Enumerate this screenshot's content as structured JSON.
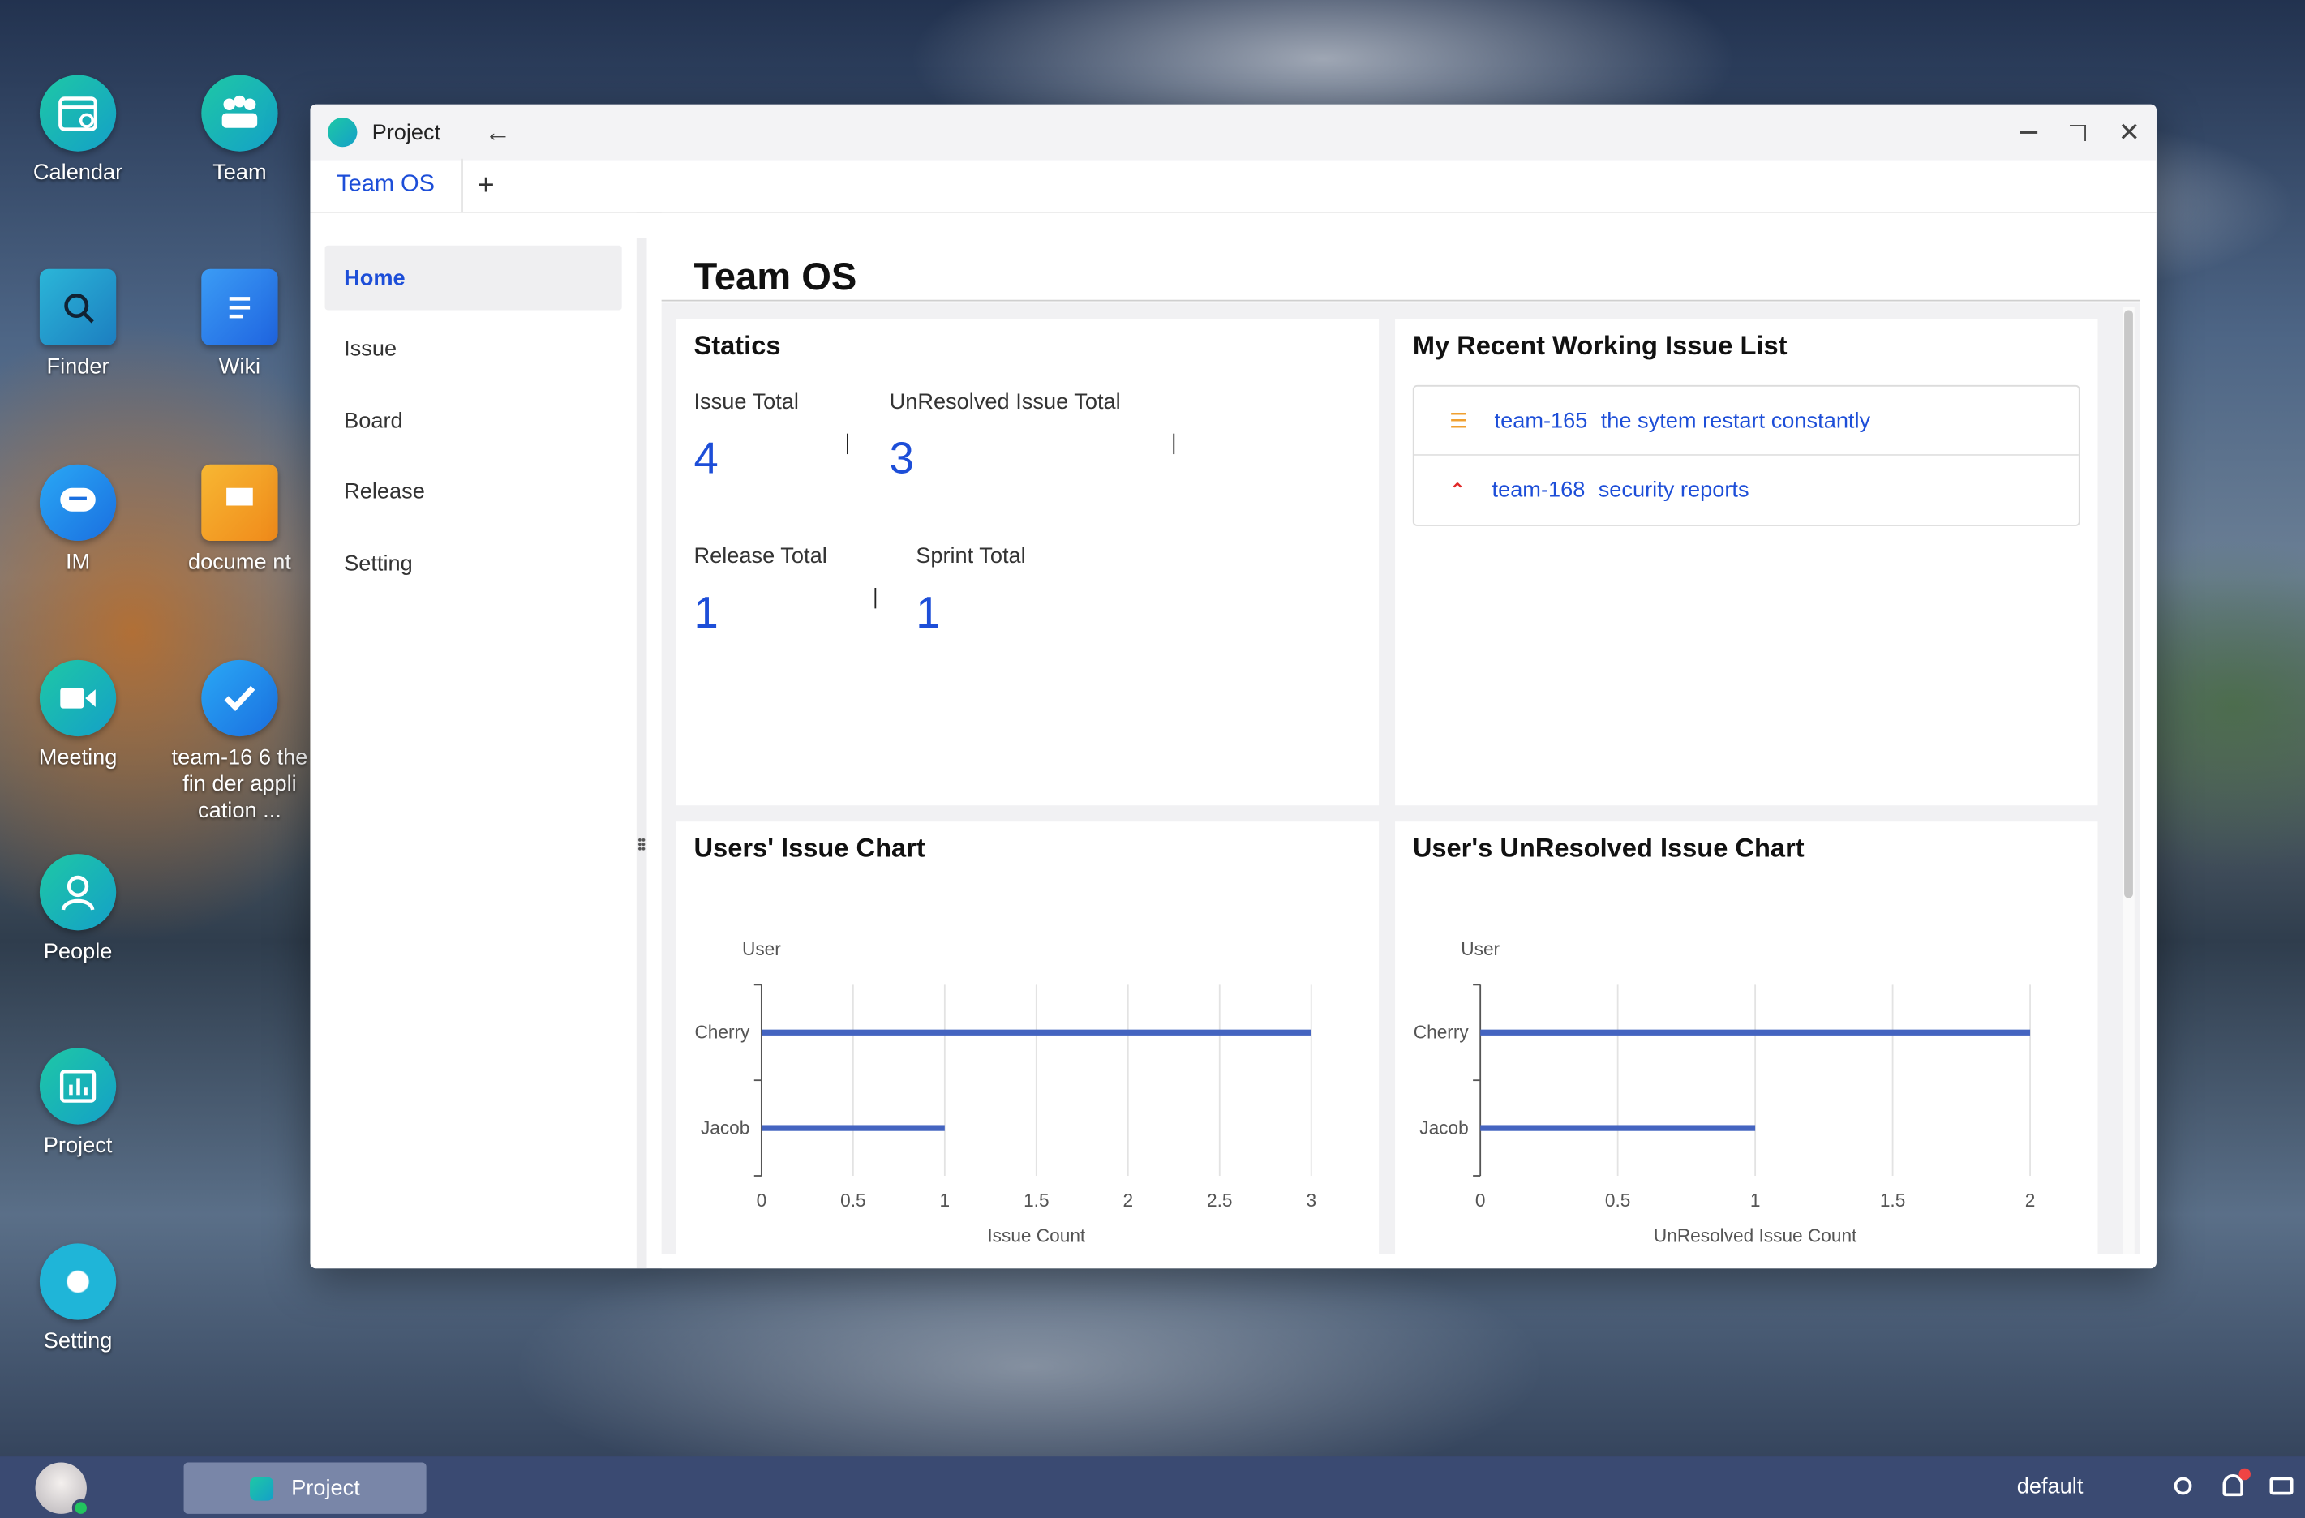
{
  "desktop": {
    "icons": [
      {
        "label": "Calendar",
        "icon": "calendar-icon"
      },
      {
        "label": "Team",
        "icon": "team-icon"
      },
      {
        "label": "Finder",
        "icon": "finder-icon"
      },
      {
        "label": "Wiki",
        "icon": "wiki-icon"
      },
      {
        "label": "IM",
        "icon": "chat-icon"
      },
      {
        "label": "docume nt",
        "icon": "folder-icon"
      },
      {
        "label": "Meeting",
        "icon": "video-icon"
      },
      {
        "label": "team-16 6 the fin der appli cation ...",
        "icon": "task-icon"
      },
      {
        "label": "People",
        "icon": "person-icon"
      },
      {
        "label": "Project",
        "icon": "project-icon"
      },
      {
        "label": "Setting",
        "icon": "gear-icon"
      }
    ]
  },
  "window": {
    "title": "Project",
    "tab": "Team OS",
    "add_tab": "+"
  },
  "sidebar": {
    "items": [
      "Home",
      "Issue",
      "Board",
      "Release",
      "Setting"
    ],
    "active": "Home"
  },
  "main": {
    "title": "Team OS",
    "statics": {
      "title": "Statics",
      "issue_total_label": "Issue Total",
      "issue_total": "4",
      "unresolved_label": "UnResolved Issue Total",
      "unresolved": "3",
      "release_label": "Release Total",
      "release": "1",
      "sprint_label": "Sprint Total",
      "sprint": "1"
    },
    "recent": {
      "title": "My Recent Working Issue List",
      "items": [
        {
          "key": "team-165",
          "text": "the sytem restart constantly",
          "priority": "list-icon"
        },
        {
          "key": "team-168",
          "text": "security reports",
          "priority": "double-chevron-up-icon"
        }
      ]
    }
  },
  "chart_data": [
    {
      "type": "bar",
      "title": "Users' Issue Chart",
      "ylabel": "User",
      "xlabel": "Issue Count",
      "categories": [
        "Cherry",
        "Jacob"
      ],
      "values": [
        3,
        1
      ],
      "xlim": [
        0,
        3
      ],
      "ticks": [
        "0",
        "0.5",
        "1",
        "1.5",
        "2",
        "2.5",
        "3"
      ],
      "color": "#4464c0"
    },
    {
      "type": "bar",
      "title": "User's UnResolved Issue Chart",
      "ylabel": "User",
      "xlabel": "UnResolved Issue Count",
      "categories": [
        "Cherry",
        "Jacob"
      ],
      "values": [
        2,
        1
      ],
      "xlim": [
        0,
        2
      ],
      "ticks": [
        "0",
        "0.5",
        "1",
        "1.5",
        "2"
      ],
      "color": "#4464c0"
    }
  ],
  "taskbar": {
    "app": "Project",
    "workspace": "default"
  },
  "colors": {
    "accent": "#1d4ed8",
    "bar": "#4464c0"
  }
}
